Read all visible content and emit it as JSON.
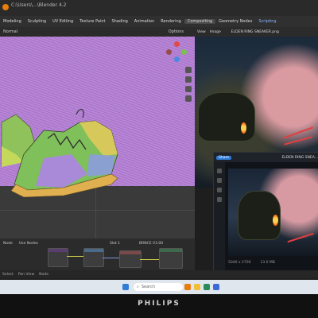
{
  "window": {
    "title": "C:\\Users\\...\\Blender 4.2"
  },
  "menubar": {
    "workspaces": [
      "Modeling",
      "Sculpting",
      "UV Editing",
      "Texture Paint",
      "Shading",
      "Animation",
      "Rendering",
      "Compositing",
      "Geometry Nodes",
      "Scripting"
    ]
  },
  "viewport": {
    "mode": "Normal",
    "options": "Options"
  },
  "nodes": {
    "tabs": [
      "Node",
      "Use Nodes"
    ],
    "slot": "Slot 1",
    "material": "BRNCE V3.00"
  },
  "render_view": {
    "view_label": "View",
    "image_label": "Image",
    "image_name": "ELDEN RING SNEAKER.png"
  },
  "photo": {
    "share": "Share",
    "title": "ELDEN RING SNEA...",
    "dims": "5040 x 2700",
    "size": "13.0 MB"
  },
  "statusbar": {
    "items": [
      "Select",
      "Pan View",
      "Node"
    ]
  },
  "taskbar": {
    "search": "Search",
    "time": "",
    "date": ""
  },
  "monitor": {
    "brand": "PHILIPS"
  },
  "colors": {
    "mesh": "#b07fd2",
    "accent": "#2e7dd8",
    "laces": "#e04040"
  },
  "icons": [
    "blender-logo",
    "search-icon",
    "windows-start-icon"
  ]
}
